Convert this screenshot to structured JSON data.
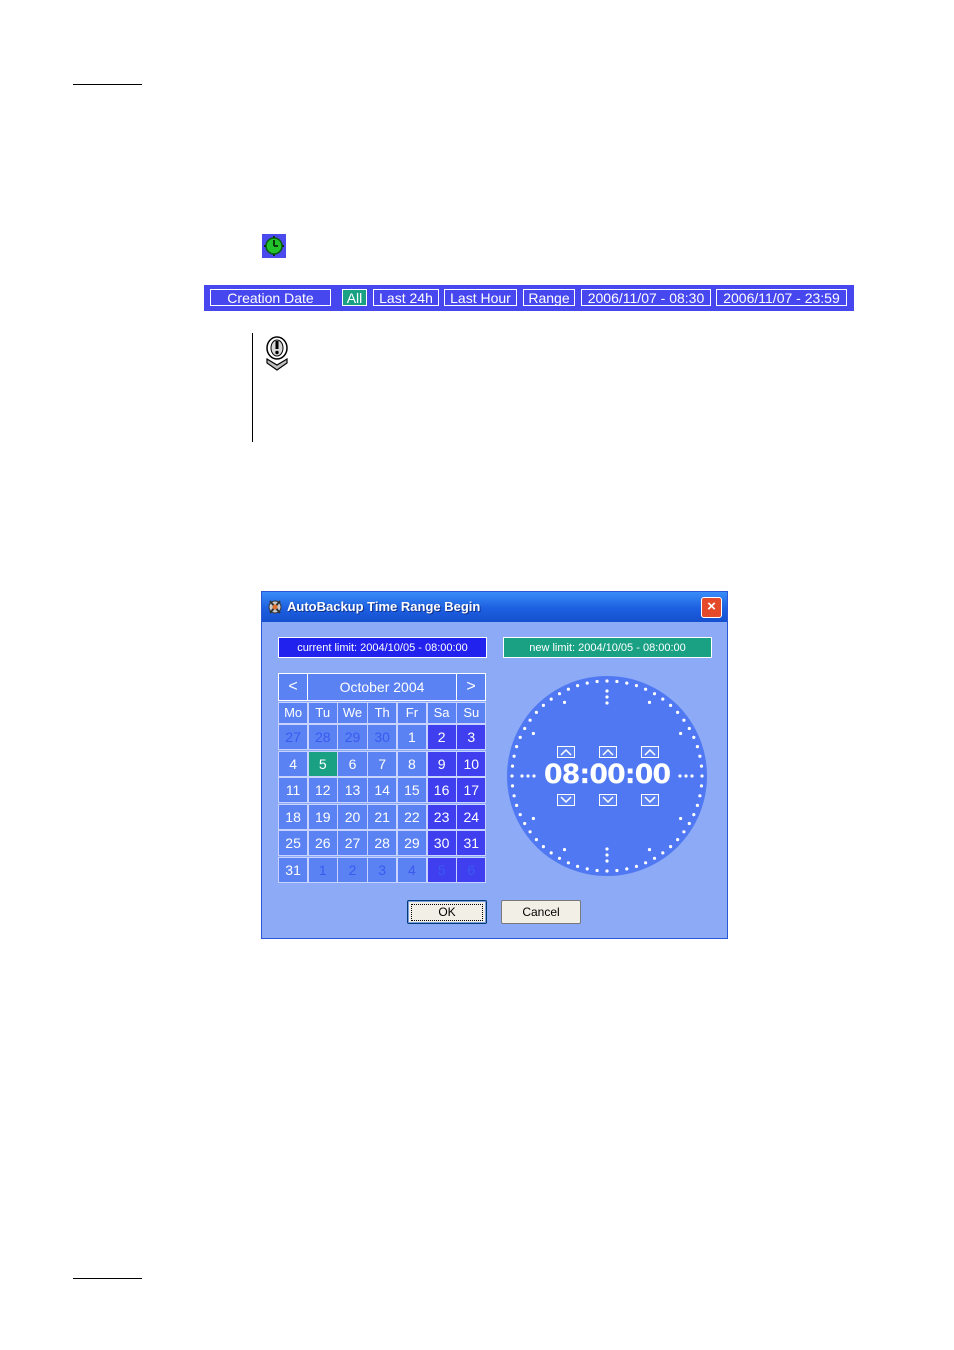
{
  "filter_bar": {
    "field": "Creation Date",
    "all": "All",
    "last24h": "Last 24h",
    "lasthour": "Last Hour",
    "range": "Range",
    "range_start": "2006/11/07 - 08:30",
    "range_end": "2006/11/07 - 23:59",
    "active_color": "#1aa184",
    "bar_color": "#4747f0"
  },
  "icons": {
    "filter_icon": "green-clock-icon",
    "note_icon": "info-note-icon"
  },
  "dialog": {
    "title": "AutoBackup Time Range Begin",
    "close": "×",
    "current_limit": "current limit: 2004/10/05 - 08:00:00",
    "new_limit": "new limit: 2004/10/05 - 08:00:00",
    "calendar": {
      "prev": "<",
      "next": ">",
      "month": "October 2004",
      "weekdays": [
        "Mo",
        "Tu",
        "We",
        "Th",
        "Fr",
        "Sa",
        "Su"
      ],
      "weeks": [
        [
          "27",
          "28",
          "29",
          "30",
          "1",
          "2",
          "3"
        ],
        [
          "4",
          "5",
          "6",
          "7",
          "8",
          "9",
          "10"
        ],
        [
          "11",
          "12",
          "13",
          "14",
          "15",
          "16",
          "17"
        ],
        [
          "18",
          "19",
          "20",
          "21",
          "22",
          "23",
          "24"
        ],
        [
          "25",
          "26",
          "27",
          "28",
          "29",
          "30",
          "31"
        ],
        [
          "31",
          "1",
          "2",
          "3",
          "4",
          "5",
          "6"
        ]
      ],
      "selected_day": "5"
    },
    "time": {
      "hours": "08",
      "minutes": "00",
      "seconds": "00",
      "separator": ":"
    },
    "ok": "OK",
    "cancel": "Cancel"
  }
}
